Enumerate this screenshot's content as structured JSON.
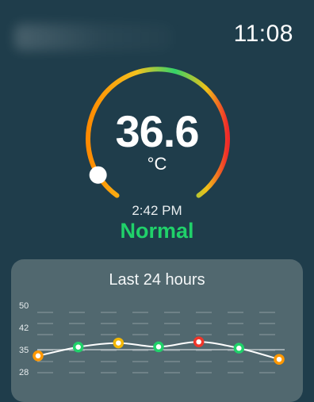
{
  "status_bar": {
    "time": "11:08"
  },
  "reading": {
    "temperature": "36.6",
    "unit": "°C",
    "time": "2:42 PM",
    "status": "Normal",
    "status_color": "#20d16a",
    "gauge_level": 0.08
  },
  "history": {
    "title": "Last 24 hours",
    "y_ticks": [
      "50",
      "42",
      "35",
      "28"
    ]
  },
  "chart_data": {
    "type": "line",
    "title": "Last 24 hours",
    "ylim": [
      28,
      50
    ],
    "yticks": [
      28,
      35,
      42,
      50
    ],
    "grid": true,
    "x": [
      0,
      1,
      2,
      3,
      4,
      5,
      6
    ],
    "series": [
      {
        "values": [
          33.3,
          36.5,
          38.3,
          36.6,
          38.8,
          36.0,
          32.2
        ],
        "point_colors": [
          "#ff9800",
          "#20d16a",
          "#f2b705",
          "#20d16a",
          "#f0362a",
          "#20d16a",
          "#ff9800"
        ]
      }
    ]
  }
}
